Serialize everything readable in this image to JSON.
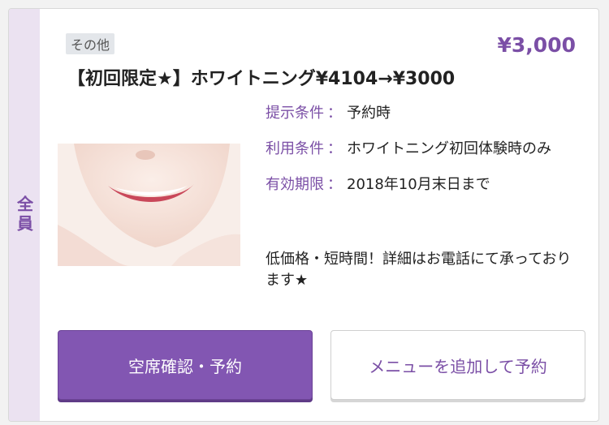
{
  "coupon": {
    "audience_label": "全員",
    "category": "その他",
    "price": "¥3,000",
    "title": "【初回限定★】ホワイトニング¥4104→¥3000",
    "details": [
      {
        "label": "提示条件",
        "value": "予約時"
      },
      {
        "label": "利用条件",
        "value": "ホワイトニング初回体験時のみ"
      },
      {
        "label": "有効期限",
        "value": "2018年10月末日まで"
      }
    ],
    "separator": "：",
    "description": "低価格・短時間！詳細はお電話にて承っております★",
    "photo_icon": "smiling-woman-photo"
  },
  "actions": {
    "check_availability_label": "空席確認・予約",
    "add_menu_label": "メニューを追加して予約"
  },
  "colors": {
    "accent": "#7b4fa6",
    "primary_button": "#8256b2",
    "side_band": "#ebe2f1"
  }
}
